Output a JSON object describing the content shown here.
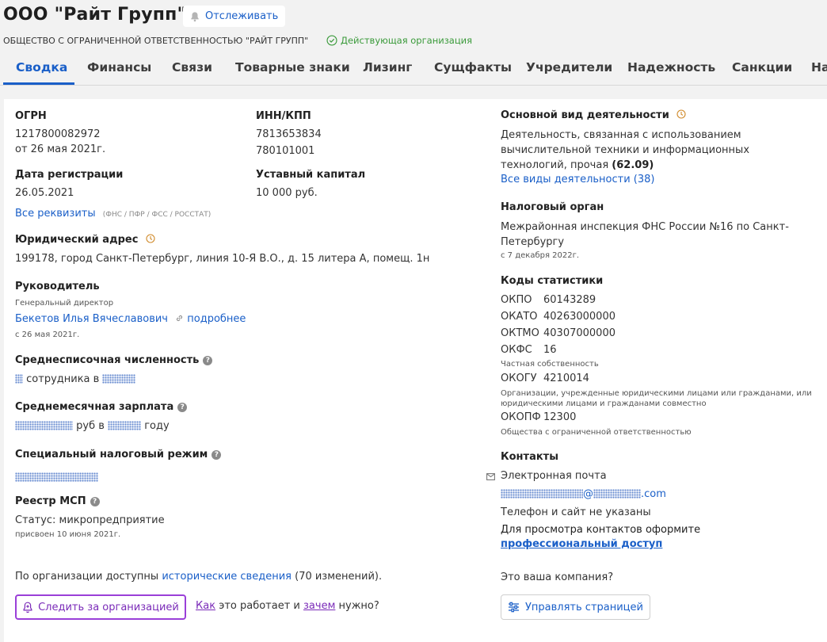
{
  "header": {
    "title": "ООО \"Райт Групп\"",
    "follow_label": "Отслеживать",
    "full_name": "ОБЩЕСТВО С ОГРАНИЧЕННОЙ ОТВЕТСТВЕННОСТЬЮ \"РАЙТ ГРУПП\"",
    "status": "Действующая организация"
  },
  "tabs": [
    "Сводка",
    "Финансы",
    "Связи",
    "Товарные знаки",
    "Лизинг",
    "Сущфакты",
    "Учредители",
    "Надежность",
    "Санкции",
    "На"
  ],
  "left": {
    "ogrn_label": "ОГРН",
    "ogrn": "1217800082972",
    "ogrn_date": "от 26 мая 2021г.",
    "inn_label": "ИНН/КПП",
    "inn": "7813653834",
    "kpp": "780101001",
    "reg_date_label": "Дата регистрации",
    "reg_date": "26.05.2021",
    "capital_label": "Уставный капитал",
    "capital": "10 000 руб.",
    "requisites_link": "Все реквизиты",
    "requisites_note": "(ФНС / ПФР / ФСС / РОССТАТ)",
    "address_label": "Юридический адрес",
    "address": "199178, город Санкт-Петербург, линия 10-Я В.О., д. 15 литера А, помещ. 1н",
    "head_label": "Руководитель",
    "head_position": "Генеральный директор",
    "head_name": "Бекетов Илья Вячеславович",
    "head_more": "подробнее",
    "head_since": "с 26 мая 2021г.",
    "headcount_label": "Среднесписочная численность",
    "headcount_mid": "сотрудника в",
    "salary_label": "Среднемесячная зарплата",
    "salary_mid": "руб в",
    "salary_end": "году",
    "tax_regime_label": "Специальный налоговый режим",
    "msp_label": "Реестр МСП",
    "msp_status": "Статус: микропредприятие",
    "msp_date": "присвоен 10 июня 2021г.",
    "history_prefix": "По организации доступны ",
    "history_link": "исторические сведения",
    "history_suffix": " (70 изменений).",
    "track_button": "Следить за организацией",
    "how_link": "Как",
    "how_mid": " это работает и ",
    "why_link": "зачем",
    "how_end": " нужно?"
  },
  "right": {
    "activity_label": "Основной вид деятельности",
    "activity_text": "Деятельность, связанная с использованием вычислительной техники и информационных технологий, прочая",
    "activity_code": "(62.09)",
    "activity_link": "Все виды деятельности (38)",
    "tax_label": "Налоговый орган",
    "tax_text": "Межрайонная инспекция ФНС России №16 по Санкт-Петербургу",
    "tax_since": "с 7 декабря 2022г.",
    "stats_label": "Коды статистики",
    "okpo_k": "ОКПО",
    "okpo_v": "60143289",
    "okato_k": "ОКАТО",
    "okato_v": "40263000000",
    "oktmo_k": "ОКТМО",
    "oktmo_v": "40307000000",
    "okfs_k": "ОКФС",
    "okfs_v": "16",
    "okfs_note": "Частная собственность",
    "okogu_k": "ОКОГУ",
    "okogu_v": "4210014",
    "okogu_note": "Организации, учрежденные юридическими лицами или гражданами, или юридическими лицами и гражданами совместно",
    "okopf_k": "ОКОПФ",
    "okopf_v": "12300",
    "okopf_note": "Общества с ограниченной ответственностью",
    "contacts_label": "Контакты",
    "email_label": "Электронная почта",
    "email_at": "@",
    "email_tld": ".com",
    "no_phone": "Телефон и сайт не указаны",
    "contacts_cta": "Для просмотра контактов оформите",
    "pro_link": "профессиональный доступ",
    "your_company": "Это ваша компания?",
    "manage_button": "Управлять страницей"
  },
  "colors": {
    "accent": "#1a5fc8",
    "track": "#9a3fd8",
    "active_status": "#3a9a3a",
    "icon_clock": "#d08a2a"
  },
  "icons": [
    "bell-icon",
    "check-circle-icon",
    "clock-icon",
    "help-icon",
    "link-icon",
    "mail-icon",
    "sliders-icon"
  ]
}
